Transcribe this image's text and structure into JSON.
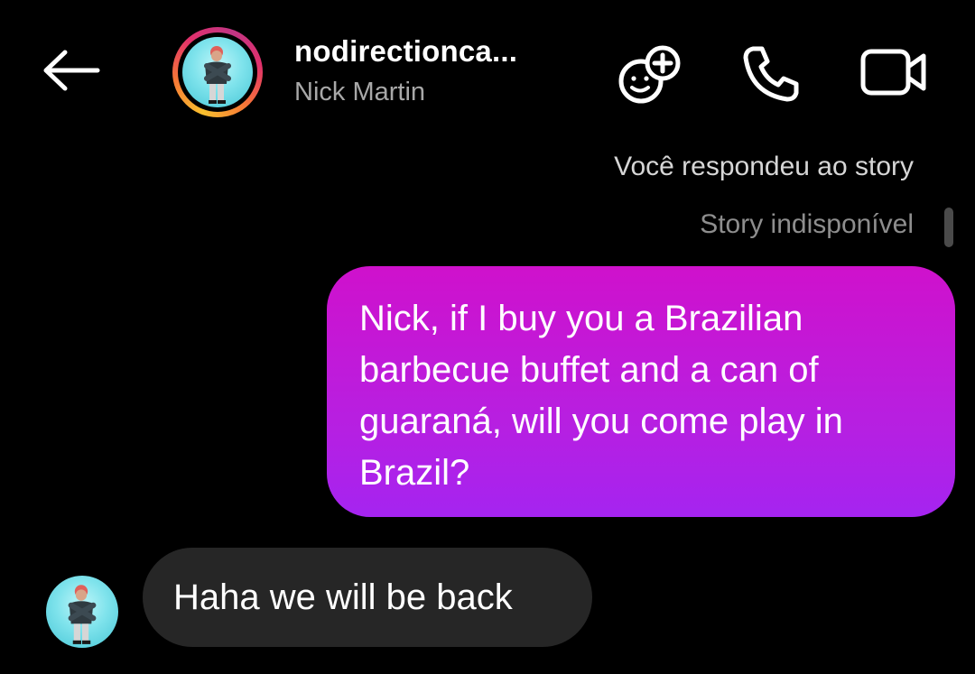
{
  "header": {
    "username": "nodirectionca...",
    "display_name": "Nick Martin",
    "icons": {
      "back": "arrow-left-icon",
      "effects": "face-effects-icon",
      "call": "phone-icon",
      "video": "video-camera-icon"
    }
  },
  "conversation": {
    "reply_note": "Você respondeu ao story",
    "story_status": "Story indisponível",
    "messages": [
      {
        "direction": "outgoing",
        "text": "Nick, if I buy you a Brazilian barbecue buffet and a can of guaraná, will you come play in Brazil?"
      },
      {
        "direction": "incoming",
        "text": "Haha we will be back"
      }
    ]
  },
  "colors": {
    "background": "#000000",
    "outgoing_bubble_top": "#cf11cc",
    "outgoing_bubble_bottom": "#a524f0",
    "incoming_bubble": "#262626",
    "secondary_text": "#a8a8a8"
  }
}
